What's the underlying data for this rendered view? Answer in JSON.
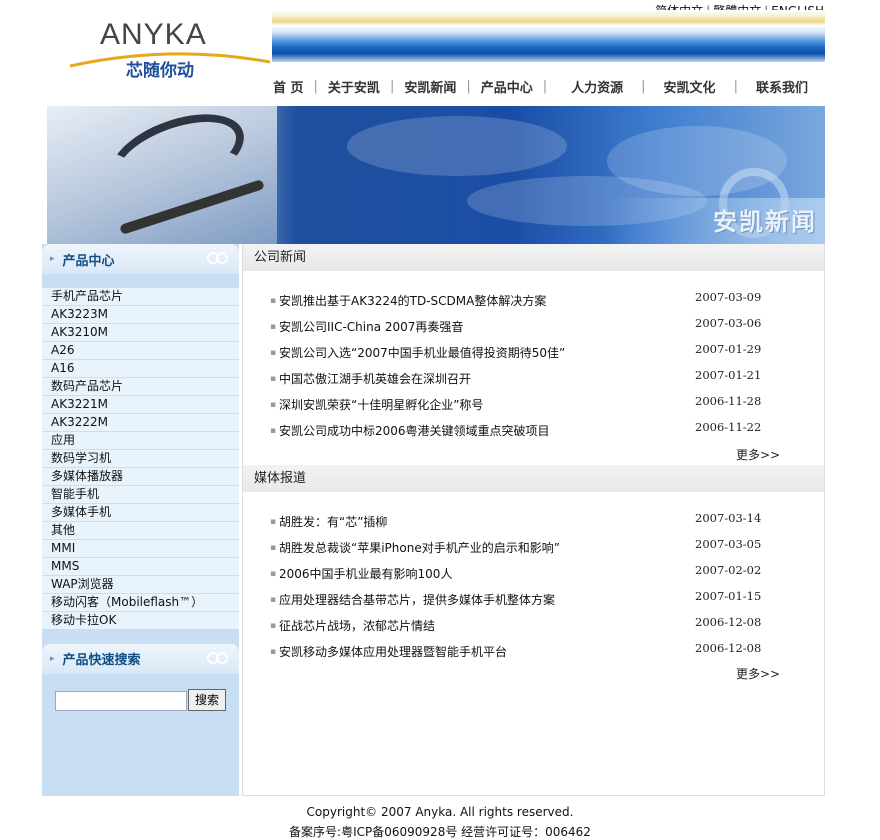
{
  "lang": [
    "简体中文",
    "繁體中文",
    "ENGLISH"
  ],
  "logo": {
    "word": "ANYKA",
    "slogan": "芯随你动"
  },
  "nav": [
    "首  页",
    "关于安凯",
    "安凯新闻",
    "产品中心",
    "人力资源",
    "安凯文化",
    "联系我们"
  ],
  "hero": {
    "title": "安凯新闻"
  },
  "sidebar": {
    "products_title": "产品中心",
    "products": [
      "手机产品芯片",
      "AK3223M",
      "AK3210M",
      "A26",
      "A16",
      "数码产品芯片",
      "AK3221M",
      "AK3222M",
      "应用",
      "数码学习机",
      "多媒体播放器",
      "智能手机",
      "多媒体手机",
      "其他",
      "MMI",
      "MMS",
      "WAP浏览器",
      "移动闪客（Mobileflash™）",
      "移动卡拉OK"
    ],
    "search_title": "产品快速搜索",
    "search_button": "搜索",
    "search_value": ""
  },
  "company_news": {
    "title": "公司新闻",
    "items": [
      {
        "title": "安凯推出基于AK3224的TD-SCDMA整体解决方案",
        "date": "2007-03-09"
      },
      {
        "title": "安凯公司IIC-China 2007再奏强音",
        "date": "2007-03-06"
      },
      {
        "title": "安凯公司入选“2007中国手机业最值得投资期待50佳”",
        "date": "2007-01-29"
      },
      {
        "title": "中国芯傲江湖手机英雄会在深圳召开",
        "date": "2007-01-21"
      },
      {
        "title": "深圳安凯荣获“十佳明星孵化企业”称号",
        "date": "2006-11-28"
      },
      {
        "title": "安凯公司成功中标2006粤港关键领域重点突破项目",
        "date": "2006-11-22"
      }
    ],
    "more": "更多>>"
  },
  "media_news": {
    "title": "媒体报道",
    "items": [
      {
        "title": "胡胜发：有“芯”插柳",
        "date": "2007-03-14"
      },
      {
        "title": "胡胜发总裁谈“苹果iPhone对手机产业的启示和影响”",
        "date": "2007-03-05"
      },
      {
        "title": "2006中国手机业最有影响100人",
        "date": "2007-02-02"
      },
      {
        "title": "应用处理器结合基带芯片，提供多媒体手机整体方案",
        "date": "2007-01-15"
      },
      {
        "title": "征战芯片战场，浓郁芯片情结",
        "date": "2006-12-08"
      },
      {
        "title": "安凯移动多媒体应用处理器暨智能手机平台",
        "date": "2006-12-08"
      }
    ],
    "more": "更多>>"
  },
  "footer": {
    "copyright": "Copyright© 2007 Anyka. All rights reserved.",
    "icp": "备案序号:粤ICP备06090928号  经营许可证号：006462"
  }
}
